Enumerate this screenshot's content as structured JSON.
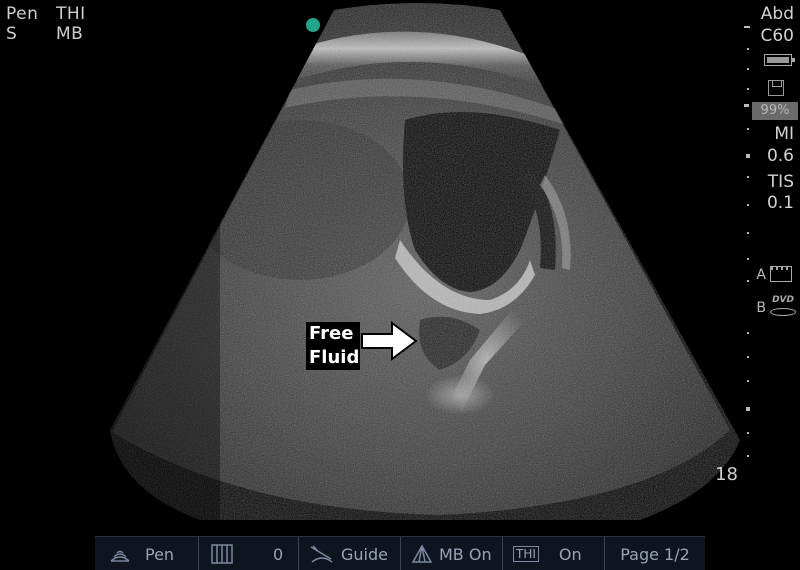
{
  "top_left": {
    "line1_col1": "Pen",
    "line2_col1": "S",
    "line1_col2": "THI",
    "line2_col2": "MB"
  },
  "right_panel": {
    "exam": "Abd",
    "transducer": "C60",
    "storage_percent": "99%",
    "mi_label": "MI",
    "mi_value": "0.6",
    "tis_label": "TIS",
    "tis_value": "0.1",
    "film_label": "A",
    "dvd_label": "B",
    "dvd_text": "DVD",
    "icons": [
      "battery-icon",
      "save-icon",
      "film-icon",
      "dvd-icon"
    ]
  },
  "depth": "18",
  "annotation": {
    "line1": "Free",
    "line2": "Fluid"
  },
  "bottom_bar": {
    "pen_label": "Pen",
    "cine_value": "0",
    "guide_label": "Guide",
    "mb_label": "MB On",
    "thi_badge": "THI",
    "thi_value": "On",
    "page_label": "Page 1/2"
  },
  "colors": {
    "orientation_marker": "#1fa58a",
    "bottom_bar_bg": "#0e1420",
    "text": "#cfcfcf"
  }
}
